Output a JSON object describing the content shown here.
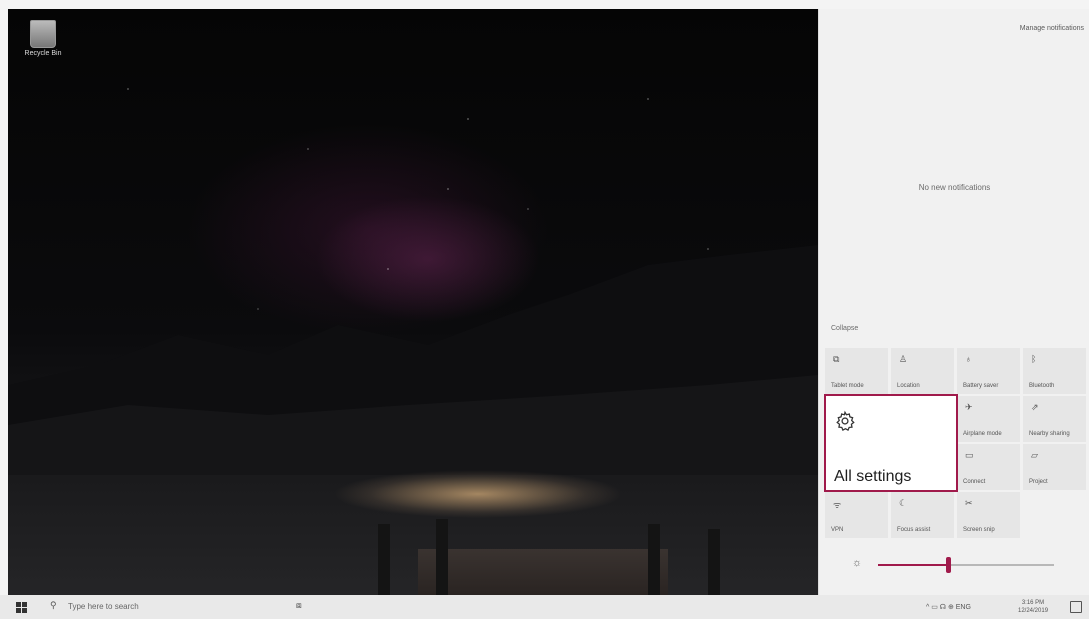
{
  "desktop": {
    "recycle_bin_label": "Recycle Bin"
  },
  "action_center": {
    "manage_notifications": "Manage notifications",
    "no_notifications": "No new notifications",
    "collapse_label": "Collapse",
    "tiles": [
      {
        "label": "Tablet mode",
        "icon": "tablet-mode-icon",
        "glyph": "⧉"
      },
      {
        "label": "Location",
        "icon": "location-icon",
        "glyph": "♙"
      },
      {
        "label": "Battery saver",
        "icon": "battery-saver-icon",
        "glyph": "♁"
      },
      {
        "label": "Bluetooth",
        "icon": "bluetooth-icon",
        "glyph": "ᛒ"
      },
      {
        "label": "Airplane mode",
        "icon": "airplane-icon",
        "glyph": "✈"
      },
      {
        "label": "Nearby sharing",
        "icon": "nearby-sharing-icon",
        "glyph": "⇗"
      },
      {
        "label": "Connect",
        "icon": "connect-icon",
        "glyph": "▭"
      },
      {
        "label": "Project",
        "icon": "project-icon",
        "glyph": "▱"
      },
      {
        "label": "VPN",
        "icon": "vpn-icon",
        "glyph": "ᯤ"
      },
      {
        "label": "Focus assist",
        "icon": "focus-assist-icon",
        "glyph": "☾"
      },
      {
        "label": "Screen snip",
        "icon": "screen-snip-icon",
        "glyph": "✂"
      }
    ],
    "all_settings": {
      "label": "All settings",
      "icon": "gear-icon"
    },
    "brightness": {
      "icon": "brightness-icon",
      "level": 0.4
    }
  },
  "taskbar": {
    "search_placeholder": "Type here to search",
    "tray_text": "^ ▭ ☊ ⊕ ENG",
    "time": "3:16 PM",
    "date": "12/24/2019"
  },
  "colors": {
    "accent": "#a01a4b",
    "panel_bg": "#f1f1f1",
    "tile_bg": "#e6e6e6"
  }
}
